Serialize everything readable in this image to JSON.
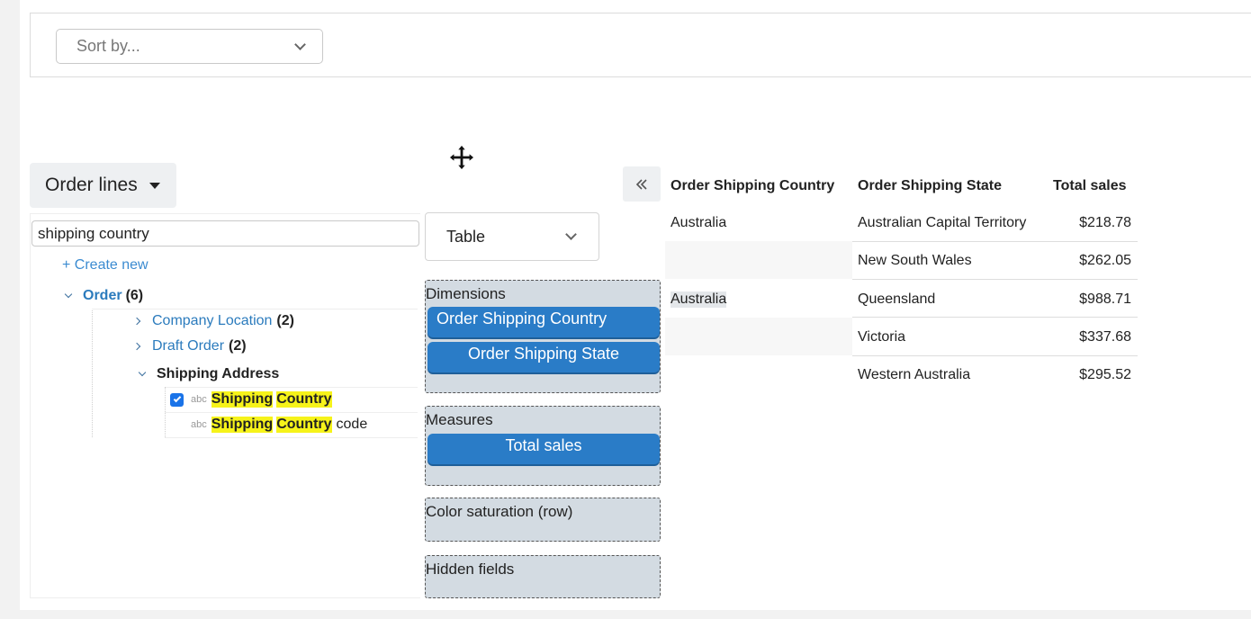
{
  "sort": {
    "placeholder": "Sort by..."
  },
  "model": {
    "label": "Order lines"
  },
  "field_search": {
    "value": "shipping country"
  },
  "create_new": "+ Create new",
  "tree": {
    "order": {
      "label": "Order",
      "count": "(6)"
    },
    "company_location": {
      "label": "Company Location",
      "count": "(2)"
    },
    "draft_order": {
      "label": "Draft Order",
      "count": "(2)"
    },
    "shipping_address": {
      "label": "Shipping Address"
    },
    "shipping_country": {
      "type": "abc",
      "word1": "Shipping",
      "word2": "Country",
      "checked": true
    },
    "shipping_country_code": {
      "type": "abc",
      "word1": "Shipping",
      "word2": "Country",
      "suffix": "code"
    }
  },
  "viz": {
    "selected": "Table"
  },
  "zones": {
    "dimensions": {
      "title": "Dimensions",
      "items": [
        "Order Shipping Country",
        "Order Shipping State"
      ]
    },
    "measures": {
      "title": "Measures",
      "items": [
        "Total sales"
      ]
    },
    "color": {
      "title": "Color saturation (row)"
    },
    "hidden": {
      "title": "Hidden fields"
    }
  },
  "table": {
    "headers": [
      "Order Shipping Country",
      "Order Shipping State",
      "Total sales"
    ],
    "rows": [
      [
        "Australia",
        "Australian Capital Territory",
        "$218.78"
      ],
      [
        "",
        "New South Wales",
        "$262.05"
      ],
      [
        "Australia",
        "Queensland",
        "$988.71"
      ],
      [
        "",
        "Victoria",
        "$337.68"
      ],
      [
        "",
        "Western Australia",
        "$295.52"
      ]
    ]
  },
  "icons": {
    "collapse": "double-chevron-left-icon",
    "move": "move-cursor-icon"
  }
}
